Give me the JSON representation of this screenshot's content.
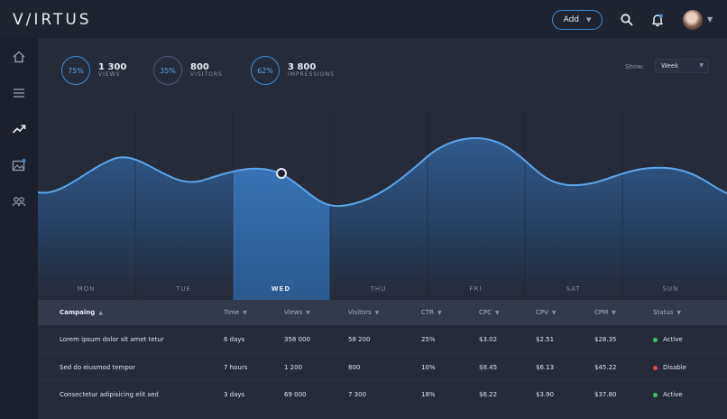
{
  "app": {
    "logo": "V/IRTUS"
  },
  "header": {
    "add_label": "Add",
    "icons": [
      "search-icon",
      "bell-icon",
      "user-avatar"
    ]
  },
  "sidebar": {
    "items": [
      {
        "icon": "home-icon"
      },
      {
        "icon": "list-icon"
      },
      {
        "icon": "trending-icon"
      },
      {
        "icon": "image-icon"
      },
      {
        "icon": "users-icon"
      }
    ]
  },
  "stats": [
    {
      "percent": "75%",
      "value": "1 300",
      "label": "VIEWS"
    },
    {
      "percent": "35%",
      "value": "800",
      "label": "VISITORS"
    },
    {
      "percent": "62%",
      "value": "3 800",
      "label": "IMPRESSIONS"
    }
  ],
  "filter": {
    "show_label": "Show:",
    "selected": "Week"
  },
  "chart": {
    "days": [
      "MON",
      "TUE",
      "WED",
      "THU",
      "FRI",
      "SAT",
      "SUN"
    ],
    "active_day": "WED",
    "colors": {
      "accent": "#3a8bd6",
      "line": "#5aa5ec"
    }
  },
  "table": {
    "headers": [
      "Campaing",
      "Time",
      "Views",
      "Visitors",
      "CTR",
      "CPC",
      "CPV",
      "CPM",
      "Status"
    ],
    "rows": [
      {
        "campaign": "Lorem ipsum dolor sit amet tetur",
        "time": "6 days",
        "views": "358 000",
        "visitors": "58 200",
        "ctr": "25%",
        "cpc": "$3.02",
        "cpv": "$2.51",
        "cpm": "$28.35",
        "status": "Active",
        "status_color": "#3fbf62"
      },
      {
        "campaign": "Sed do eiusmod tempor",
        "time": "7 hours",
        "views": "1 200",
        "visitors": "800",
        "ctr": "10%",
        "cpc": "$8.45",
        "cpv": "$6.13",
        "cpm": "$45.22",
        "status": "Disable",
        "status_color": "#e24c4c"
      },
      {
        "campaign": "Consectetur adipisicing elit sed",
        "time": "3 days",
        "views": "69 000",
        "visitors": "7 300",
        "ctr": "18%",
        "cpc": "$6.22",
        "cpv": "$3.90",
        "cpm": "$37.80",
        "status": "Active",
        "status_color": "#3fbf62"
      }
    ]
  }
}
